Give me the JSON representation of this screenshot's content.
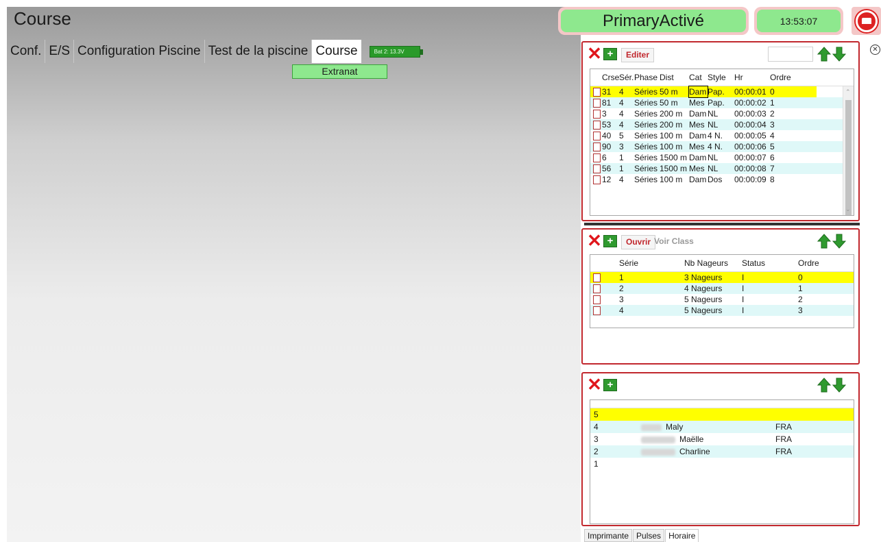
{
  "page": {
    "title": "Course",
    "status": "PrimaryActivé",
    "clock": "13:53:07"
  },
  "nav": {
    "tabs": [
      "Conf.",
      "E/S",
      "Configuration Piscine",
      "Test de la piscine",
      "Course"
    ],
    "battery": "Bat 2: 13.3V",
    "extranat": "Extranat"
  },
  "courses": {
    "edit_label": "Editer",
    "headers": [
      "Crse",
      "Sér.",
      "Phase",
      "Dist",
      "Cat",
      "Style",
      "Hr",
      "Ordre"
    ],
    "rows": [
      [
        "31",
        "4",
        "Séries",
        "50 m",
        "Dam",
        "Pap.",
        "00:00:01",
        "0"
      ],
      [
        "81",
        "4",
        "Séries",
        "50 m",
        "Mes",
        "Pap.",
        "00:00:02",
        "1"
      ],
      [
        "3",
        "4",
        "Séries",
        "200 m",
        "Dam",
        "NL",
        "00:00:03",
        "2"
      ],
      [
        "53",
        "4",
        "Séries",
        "200 m",
        "Mes",
        "NL",
        "00:00:04",
        "3"
      ],
      [
        "40",
        "5",
        "Séries",
        "100 m",
        "Dam",
        "4 N.",
        "00:00:05",
        "4"
      ],
      [
        "90",
        "3",
        "Séries",
        "100 m",
        "Mes",
        "4 N.",
        "00:00:06",
        "5"
      ],
      [
        "6",
        "1",
        "Séries",
        "1500 m",
        "Dam",
        "NL",
        "00:00:07",
        "6"
      ],
      [
        "56",
        "1",
        "Séries",
        "1500 m",
        "Mes",
        "NL",
        "00:00:08",
        "7"
      ],
      [
        "12",
        "4",
        "Séries",
        "100 m",
        "Dam",
        "Dos",
        "00:00:09",
        "8"
      ]
    ]
  },
  "series": {
    "open_label": "Ouvrir",
    "ranking_label": "Voir Class",
    "headers": [
      "Série",
      "Nb Nageurs",
      "Status",
      "Ordre"
    ],
    "rows": [
      [
        "1",
        "3 Nageurs",
        "I",
        "0"
      ],
      [
        "2",
        "4 Nageurs",
        "I",
        "1"
      ],
      [
        "3",
        "5 Nageurs",
        "I",
        "2"
      ],
      [
        "4",
        "5 Nageurs",
        "I",
        "3"
      ]
    ]
  },
  "swimmers": {
    "rows": [
      {
        "lane": "5",
        "name": "",
        "nation": ""
      },
      {
        "lane": "4",
        "name": "Maly",
        "nation": "FRA"
      },
      {
        "lane": "3",
        "name": "Maëlle",
        "nation": "FRA"
      },
      {
        "lane": "2",
        "name": "Charline",
        "nation": "FRA"
      },
      {
        "lane": "1",
        "name": "",
        "nation": ""
      }
    ]
  },
  "bottom_tabs": [
    "Imprimante",
    "Pulses",
    "Horaire"
  ],
  "colors": {
    "accent_red": "#c1272d",
    "status_green": "#8ee88e",
    "highlight_row": "#ffff00",
    "alt_row": "#dff8f8"
  }
}
